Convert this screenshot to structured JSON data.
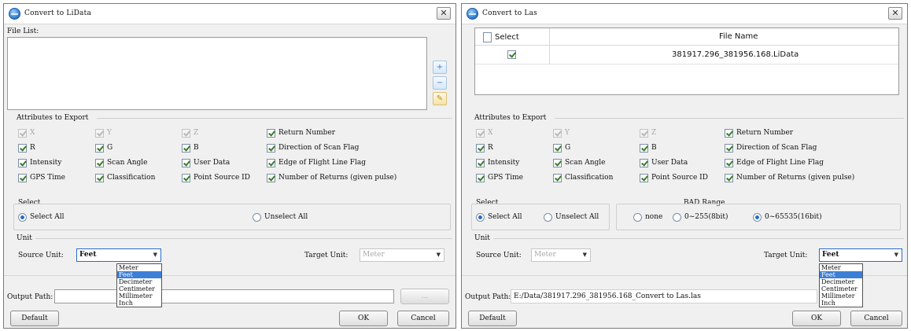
{
  "left": {
    "title": "Convert to LiData",
    "file_list_label": "File List:",
    "attributes_label": "Attributes to Export",
    "attributes": [
      {
        "label": "X",
        "checked": true,
        "disabled": true
      },
      {
        "label": "Y",
        "checked": true,
        "disabled": true
      },
      {
        "label": "Z",
        "checked": true,
        "disabled": true
      },
      {
        "label": "Return Number",
        "checked": true,
        "disabled": false
      },
      {
        "label": "R",
        "checked": true,
        "disabled": false
      },
      {
        "label": "G",
        "checked": true,
        "disabled": false
      },
      {
        "label": "B",
        "checked": true,
        "disabled": false
      },
      {
        "label": "Direction of Scan Flag",
        "checked": true,
        "disabled": false
      },
      {
        "label": "Intensity",
        "checked": true,
        "disabled": false
      },
      {
        "label": "Scan Angle",
        "checked": true,
        "disabled": false
      },
      {
        "label": "User Data",
        "checked": true,
        "disabled": false
      },
      {
        "label": "Edge of Flight Line Flag",
        "checked": true,
        "disabled": false
      },
      {
        "label": "GPS Time",
        "checked": true,
        "disabled": false
      },
      {
        "label": "Classification",
        "checked": true,
        "disabled": false
      },
      {
        "label": "Point Source ID",
        "checked": true,
        "disabled": false
      },
      {
        "label": "Number of Returns (given pulse)",
        "checked": true,
        "disabled": false
      }
    ],
    "select_label": "Select",
    "select_all": "Select All",
    "unselect_all": "Unselect All",
    "unit_label": "Unit",
    "source_unit_label": "Source Unit:",
    "source_unit_value": "Feet",
    "target_unit_label": "Target Unit:",
    "target_unit_value": "Meter",
    "unit_options": [
      "Meter",
      "Feet",
      "Decimeter",
      "Centimeter",
      "Millimeter",
      "Inch"
    ],
    "selected_option": "Feet",
    "output_path_label": "Output Path:",
    "output_path_value": "",
    "browse_label": "...",
    "default_label": "Default",
    "ok_label": "OK",
    "cancel_label": "Cancel"
  },
  "right": {
    "title": "Convert to Las",
    "table_headers": {
      "select": "Select",
      "file_name": "File Name"
    },
    "rows": [
      {
        "checked": true,
        "file_name": "381917.296_381956.168.LiData"
      }
    ],
    "attributes_label": "Attributes to Export",
    "attributes": [
      {
        "label": "X",
        "checked": true,
        "disabled": true
      },
      {
        "label": "Y",
        "checked": true,
        "disabled": true
      },
      {
        "label": "Z",
        "checked": true,
        "disabled": true
      },
      {
        "label": "Return Number",
        "checked": true,
        "disabled": false
      },
      {
        "label": "R",
        "checked": true,
        "disabled": false
      },
      {
        "label": "G",
        "checked": true,
        "disabled": false
      },
      {
        "label": "B",
        "checked": true,
        "disabled": false
      },
      {
        "label": "Direction of Scan Flag",
        "checked": true,
        "disabled": false
      },
      {
        "label": "Intensity",
        "checked": true,
        "disabled": false
      },
      {
        "label": "Scan Angle",
        "checked": true,
        "disabled": false
      },
      {
        "label": "User Data",
        "checked": true,
        "disabled": false
      },
      {
        "label": "Edge of Flight Line Flag",
        "checked": true,
        "disabled": false
      },
      {
        "label": "GPS Time",
        "checked": true,
        "disabled": false
      },
      {
        "label": "Classification",
        "checked": true,
        "disabled": false
      },
      {
        "label": "Point Source ID",
        "checked": true,
        "disabled": false
      },
      {
        "label": "Number of Returns (given pulse)",
        "checked": true,
        "disabled": false
      }
    ],
    "select_label": "Select",
    "select_all": "Select All",
    "unselect_all": "Unselect All",
    "bad_range_label": "BAD Range",
    "bad_range_options": [
      "none",
      "0~255(8bit)",
      "0~65535(16bit)"
    ],
    "bad_range_selected": 2,
    "unit_label": "Unit",
    "source_unit_label": "Source Unit:",
    "source_unit_value": "Meter",
    "target_unit_label": "Target Unit:",
    "target_unit_value": "Feet",
    "unit_options": [
      "Meter",
      "Feet",
      "Decimeter",
      "Centimeter",
      "Millimeter",
      "Inch"
    ],
    "selected_option": "Feet",
    "output_path_label": "Output Path:",
    "output_path_value": "E:/Data/381917.296_381956.168_Convert to Las.las",
    "default_label": "Default",
    "ok_label": "OK",
    "cancel_label": "Cancel"
  }
}
